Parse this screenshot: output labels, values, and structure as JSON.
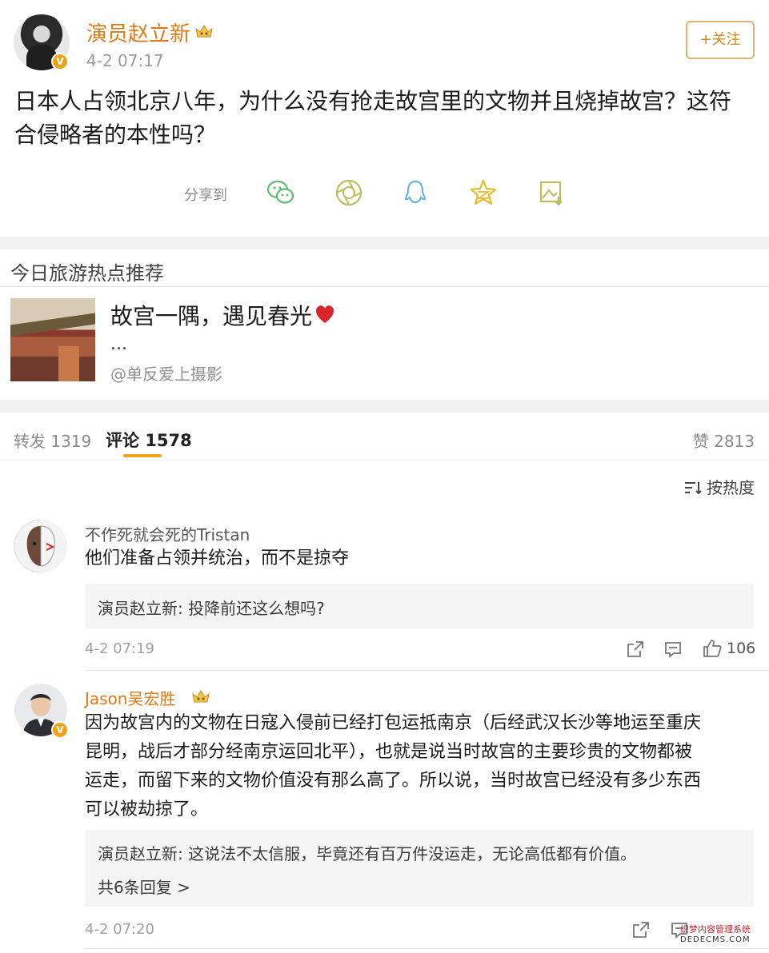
{
  "post": {
    "author": "演员赵立新",
    "time": "4-2 07:17",
    "follow_label": "+关注",
    "text": "日本人占领北京八年，为什么没有抢走故宫里的文物并且烧掉故宫？这符合侵略者的本性吗？",
    "share_label": "分享到",
    "share_icons": [
      "wechat-icon",
      "moments-icon",
      "qq-icon",
      "qzone-icon",
      "save-image-icon"
    ]
  },
  "recommend": {
    "section_title": "今日旅游热点推荐",
    "headline": "故宫一隅，遇见春光",
    "ellipsis": "...",
    "source": "@单反爱上摄影"
  },
  "tabs": {
    "repost": "转发 1319",
    "comment": "评论 1578",
    "like": "赞 2813"
  },
  "sort_label": "按热度",
  "comments": [
    {
      "name": "不作死就会死的Tristan",
      "text": "他们准备占领并统治，而不是掠夺",
      "reply": "演员赵立新: 投降前还这么想吗?",
      "time": "4-2 07:19",
      "likes": "106"
    },
    {
      "name": "Jason吴宏胜",
      "text_lines": [
        "因为故宫内的文物在日寇入侵前已经打包运抵南京（后经武汉长沙等地运至重庆",
        "昆明，战后才部分经南京运回北平），也就是说当时故宫的主要珍贵的文物都被",
        "运走，而留下来的文物价值没有那么高了。所以说，当时故宫已经没有多少东西",
        "可以被劫掠了。"
      ],
      "reply": "演员赵立新: 这说法不太信服，毕竟还有百万件没运走，无论高低都有价值。",
      "more_replies": "共6条回复 >",
      "time": "4-2 07:20"
    }
  ],
  "watermark": {
    "line1": "织梦内容管理系统",
    "line2": "DEDECMS.COM"
  },
  "colors": {
    "author_orange": "#e07a16",
    "accent": "#f2a51b",
    "background": "#ffffff",
    "separator": "#f1f1f1"
  }
}
